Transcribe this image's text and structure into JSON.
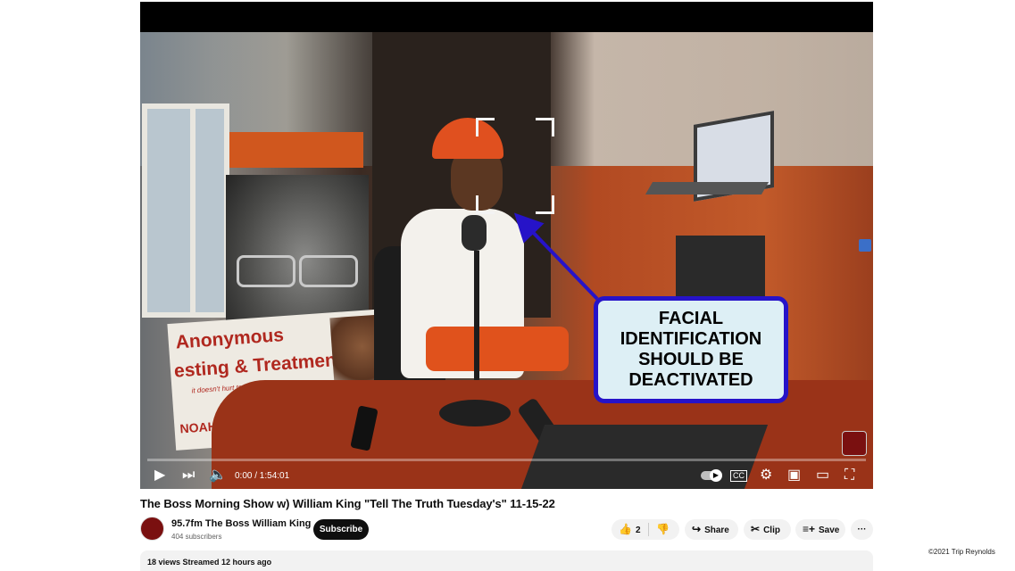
{
  "annotation": {
    "lines": [
      "FACIAL",
      "IDENTIFICATION",
      "SHOULD BE",
      "DEACTIVATED"
    ],
    "border_color": "#2613c8",
    "fill_color": "#ddeff5",
    "arrow_color": "#2613c8"
  },
  "scene": {
    "sign_title": "Anonymous",
    "sign_subtitle": "esting & Treatment",
    "sign_small": "it doesn't hurt to be on the safe side.",
    "sign_clinic": "NOAH Free Clinic"
  },
  "player": {
    "time": "0:00 / 1:54:01",
    "progress": 0,
    "icons": [
      "play-icon",
      "next-icon",
      "volume-icon",
      "autoplay-toggle",
      "captions-icon",
      "settings-icon",
      "miniplayer-icon",
      "theater-icon",
      "fullscreen-icon"
    ],
    "cc_label": "CC"
  },
  "video": {
    "title": "The Boss Morning Show w) William King \"Tell The Truth Tuesday's\" 11-15-22",
    "channel": "95.7fm The Boss William King",
    "subscribers": "404 subscribers",
    "subscribe_label": "Subscribe",
    "likes": "2",
    "share_label": "Share",
    "clip_label": "Clip",
    "save_label": "Save",
    "more_label": "···"
  },
  "description": {
    "summary": "18 views  Streamed 12 hours ago"
  },
  "copyright": "©2021 Trip Reynolds"
}
